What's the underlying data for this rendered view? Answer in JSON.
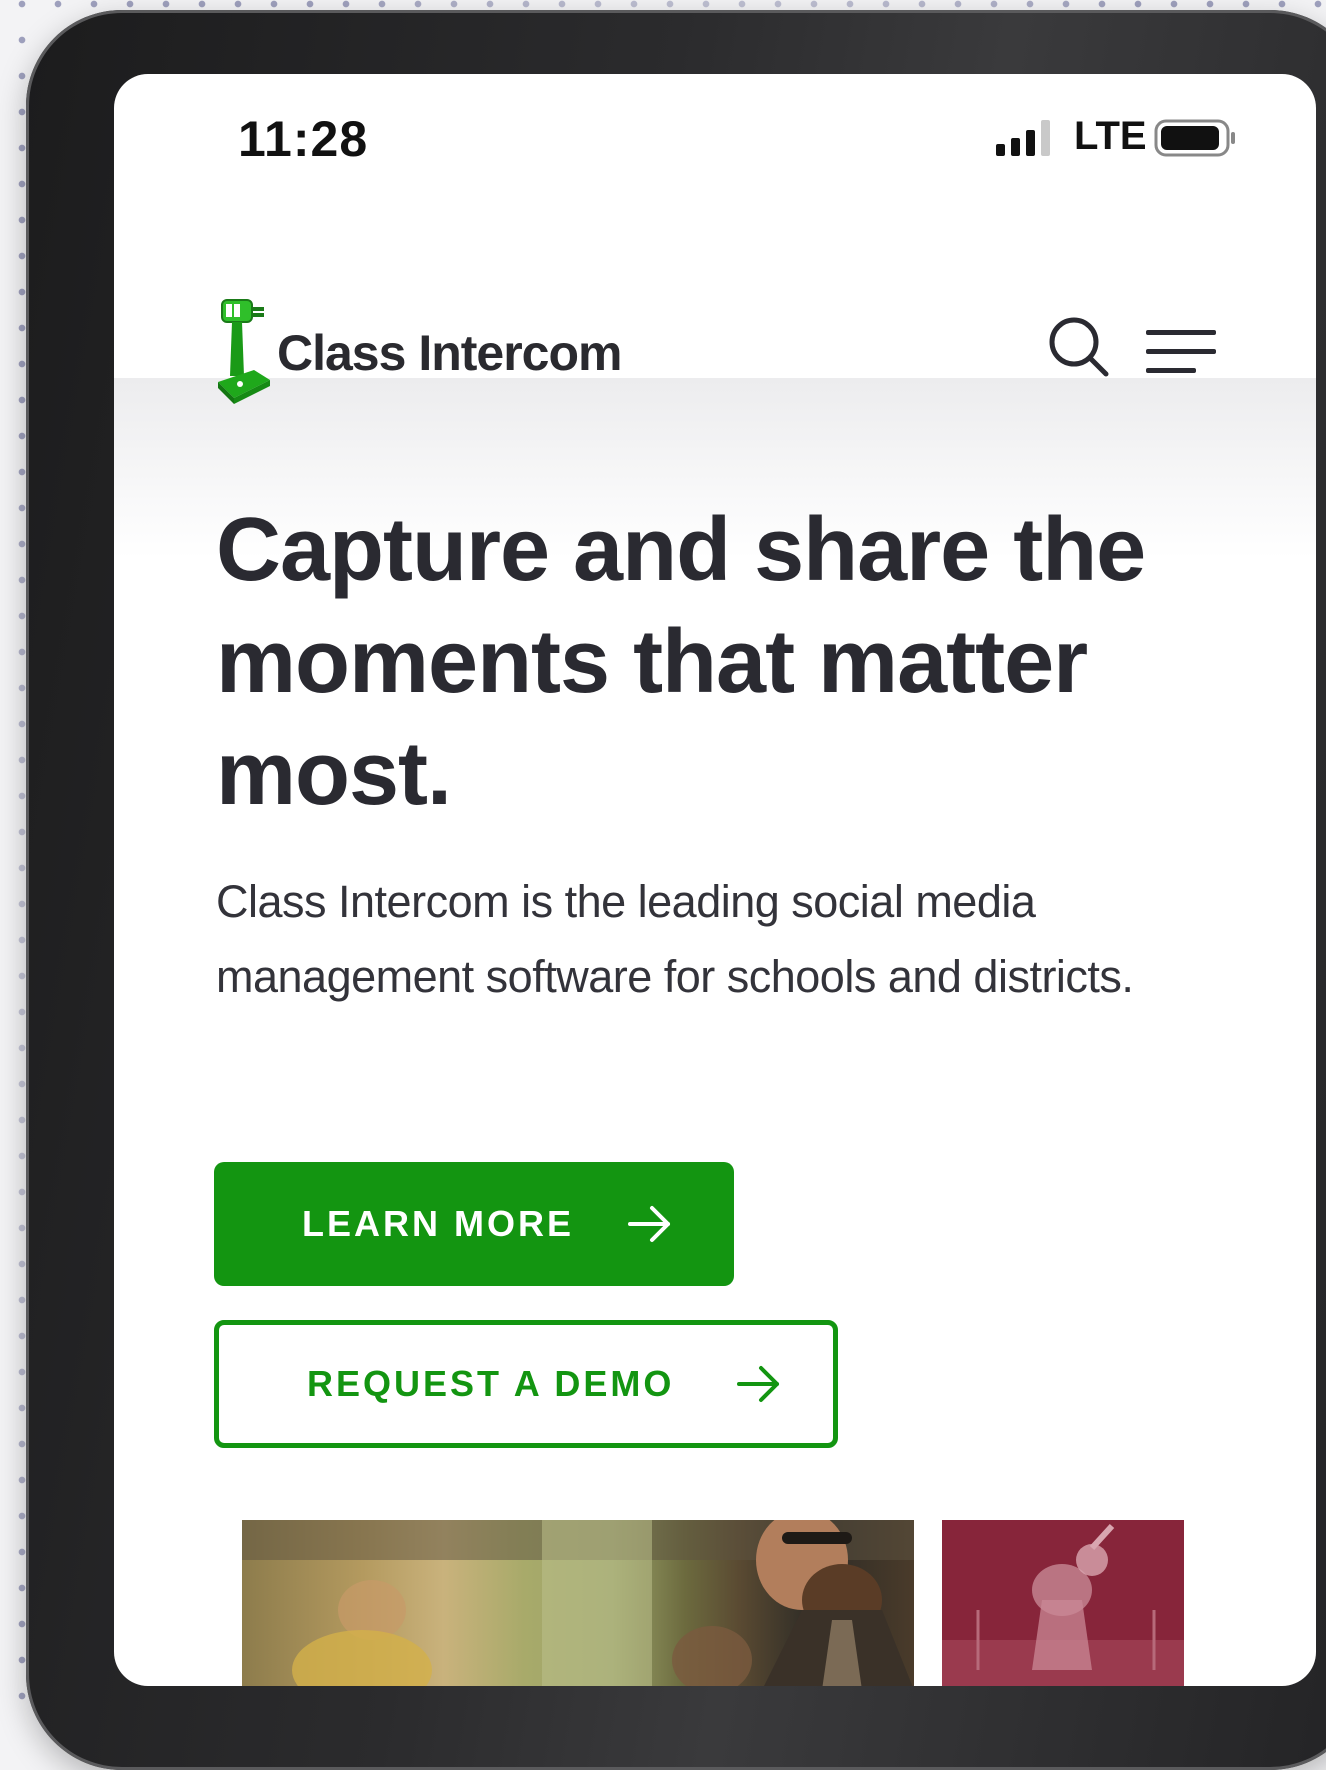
{
  "status_bar": {
    "time": "11:28",
    "network": "LTE",
    "icons": [
      "signal-icon",
      "battery-icon"
    ]
  },
  "header": {
    "logo_text": "Class Intercom",
    "logo_icon": "intercom-microphone-logo",
    "icons": [
      "search-icon",
      "hamburger-menu-icon"
    ]
  },
  "hero": {
    "title": "Capture and share the moments that matter most.",
    "description": "Class Intercom is the leading social media management software for schools and districts.",
    "primary_button": "LEARN MORE",
    "secondary_button": "REQUEST A DEMO",
    "arrow_icon": "arrow-right-icon"
  },
  "colors": {
    "brand_green": "#139511",
    "text_dark": "#2a2a31",
    "photo_accent": "#87253a"
  }
}
